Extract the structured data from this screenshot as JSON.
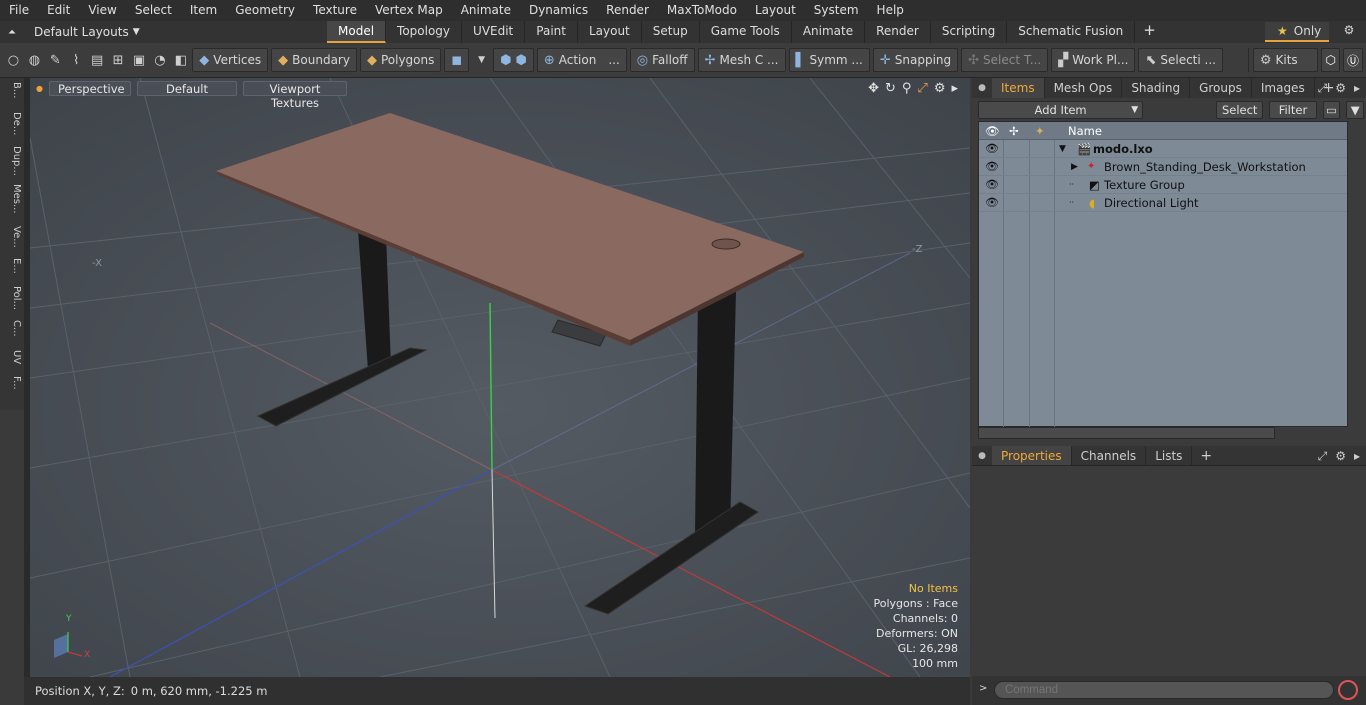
{
  "menu": [
    "File",
    "Edit",
    "View",
    "Select",
    "Item",
    "Geometry",
    "Texture",
    "Vertex Map",
    "Animate",
    "Dynamics",
    "Render",
    "MaxToModo",
    "Layout",
    "System",
    "Help"
  ],
  "layouts_label": "Default Layouts",
  "tabs": [
    "Model",
    "Topology",
    "UVEdit",
    "Paint",
    "Layout",
    "Setup",
    "Game Tools",
    "Animate",
    "Render",
    "Scripting",
    "Schematic Fusion"
  ],
  "active_tab": "Model",
  "only_label": "Only",
  "toolbar": {
    "vertices": "Vertices",
    "boundary": "Boundary",
    "polygons": "Polygons",
    "action": "Action",
    "falloff": "Falloff",
    "mesh_c": "Mesh C ...",
    "symm": "Symm ...",
    "snapping": "Snapping",
    "select_t": "Select T...",
    "work_pl": "Work Pl...",
    "selecti": "Selecti ...",
    "kits": "Kits"
  },
  "left_tabs": [
    "B...",
    "De...",
    "Dup...",
    "Mes...",
    "Ve...",
    "E...",
    "Pol...",
    "C...",
    "UV",
    "F..."
  ],
  "viewport": {
    "view_mode": "Perspective",
    "shading": "Default",
    "textures": "Viewport Textures",
    "stats": {
      "selection": "No Items",
      "polygons": "Polygons : Face",
      "channels": "Channels: 0",
      "deformers": "Deformers: ON",
      "gl": "GL: 26,298",
      "grid": "100 mm"
    },
    "axis_labels": {
      "neg_x": "-X",
      "neg_z": "-Z"
    },
    "gizmo": {
      "y": "Y",
      "x": "X"
    }
  },
  "status": {
    "label": "Position X, Y, Z:",
    "value": "0 m, 620 mm, -1.225 m"
  },
  "items_panel": {
    "tabs": [
      "Items",
      "Mesh Ops",
      "Shading",
      "Groups",
      "Images"
    ],
    "active_tab": "Items",
    "add_item": "Add Item",
    "select": "Select",
    "filter": "Filter",
    "column_name": "Name",
    "items": [
      {
        "name": "modo.lxo",
        "icon": "scene-icon"
      },
      {
        "name": "Brown_Standing_Desk_Workstation",
        "icon": "mesh-icon"
      },
      {
        "name": "Texture Group",
        "icon": "texture-icon"
      },
      {
        "name": "Directional Light",
        "icon": "light-icon"
      }
    ]
  },
  "props_panel": {
    "tabs": [
      "Properties",
      "Channels",
      "Lists"
    ],
    "active_tab": "Properties"
  },
  "command_placeholder": "Command",
  "colors": {
    "accent": "#e8a33a",
    "viewport_bg": "#494f57",
    "desk_top": "#8a6a60"
  }
}
